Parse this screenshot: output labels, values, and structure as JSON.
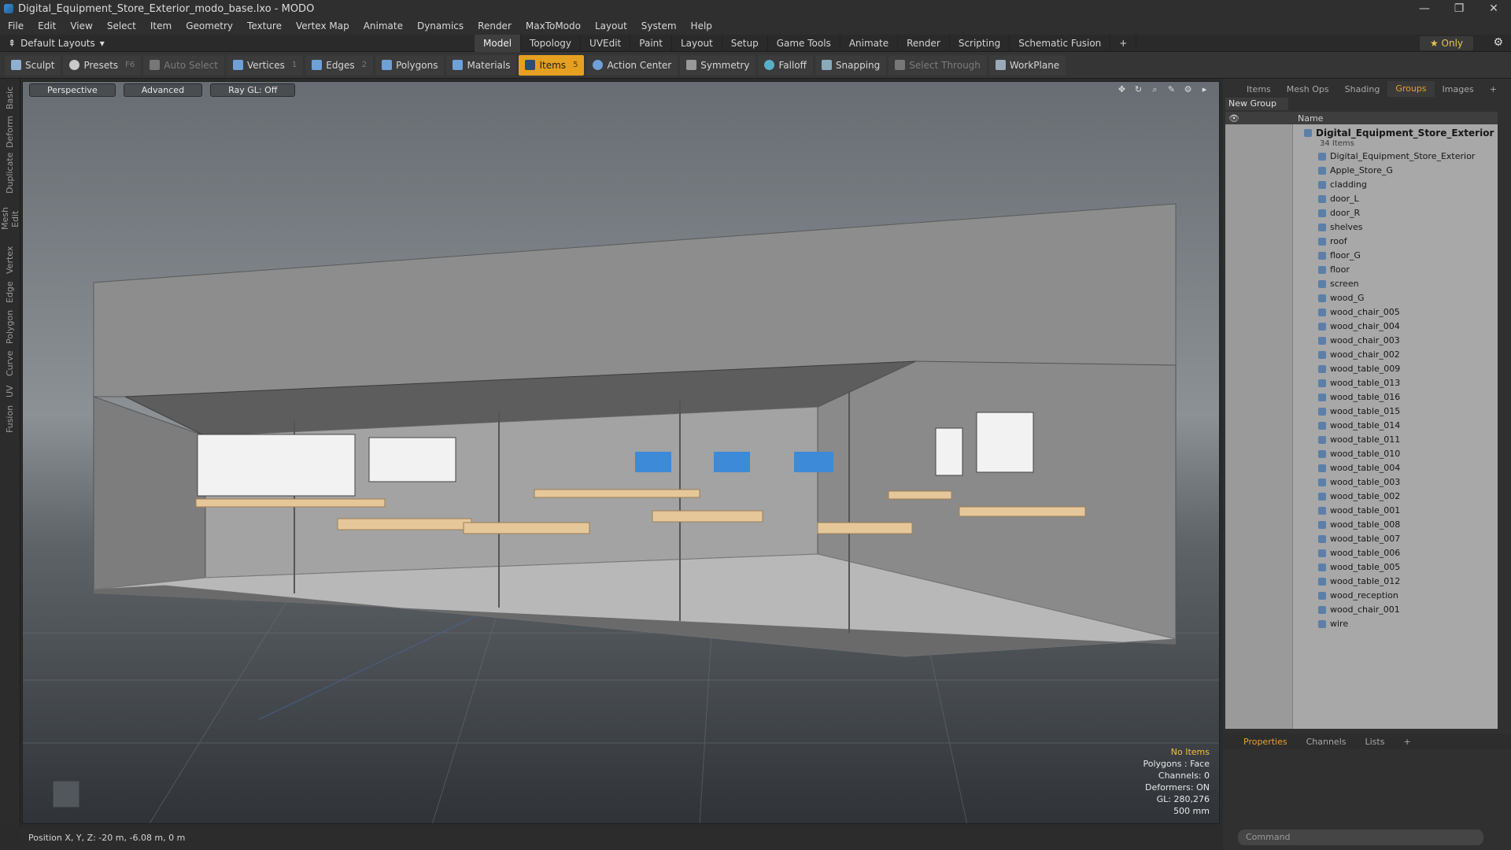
{
  "title": "Digital_Equipment_Store_Exterior_modo_base.lxo - MODO",
  "window_controls": {
    "minimize": "—",
    "maximize": "❐",
    "close": "✕"
  },
  "menu": [
    "File",
    "Edit",
    "View",
    "Select",
    "Item",
    "Geometry",
    "Texture",
    "Vertex Map",
    "Animate",
    "Dynamics",
    "Render",
    "MaxToModo",
    "Layout",
    "System",
    "Help"
  ],
  "layout_label": "Default Layouts",
  "layout_tabs": [
    "Model",
    "Topology",
    "UVEdit",
    "Paint",
    "Layout",
    "Setup",
    "Game Tools",
    "Animate",
    "Render",
    "Scripting",
    "Schematic Fusion"
  ],
  "layout_add": "+",
  "only_label": "Only",
  "toolbar": {
    "sculpt": "Sculpt",
    "presets": "Presets",
    "presets_key": "F6",
    "auto_select": "Auto Select",
    "vertices": "Vertices",
    "vertices_key": "1",
    "edges": "Edges",
    "edges_key": "2",
    "polygons": "Polygons",
    "materials": "Materials",
    "items": "Items",
    "items_key": "5",
    "action_center": "Action Center",
    "symmetry": "Symmetry",
    "falloff": "Falloff",
    "snapping": "Snapping",
    "select_through": "Select Through",
    "workplane": "WorkPlane"
  },
  "left_tabs": [
    "Basic",
    "Deform",
    "Duplicate",
    "Mesh Edit",
    "Vertex",
    "Edge",
    "Polygon",
    "Curve",
    "UV",
    "Fusion"
  ],
  "viewport": {
    "perspective": "Perspective",
    "advanced": "Advanced",
    "raygl": "Ray GL: Off",
    "stats": {
      "no_items": "No Items",
      "polygons": "Polygons : Face",
      "channels": "Channels: 0",
      "deformers": "Deformers: ON",
      "gl": "GL: 280,276",
      "scale": "500 mm"
    }
  },
  "status": "Position X, Y, Z:  -20 m, -6.08 m, 0 m",
  "right_panel": {
    "tabs": [
      "Items",
      "Mesh Ops",
      "Shading",
      "Groups",
      "Images",
      "+"
    ],
    "new_group": "New Group",
    "name_header": "Name",
    "root": "Digital_Equipment_Store_Exterior",
    "root_count": "34 Items",
    "items": [
      "Digital_Equipment_Store_Exterior",
      "Apple_Store_G",
      "cladding",
      "door_L",
      "door_R",
      "shelves",
      "roof",
      "floor_G",
      "floor",
      "screen",
      "wood_G",
      "wood_chair_005",
      "wood_chair_004",
      "wood_chair_003",
      "wood_chair_002",
      "wood_table_009",
      "wood_table_013",
      "wood_table_016",
      "wood_table_015",
      "wood_table_014",
      "wood_table_011",
      "wood_table_010",
      "wood_table_004",
      "wood_table_003",
      "wood_table_002",
      "wood_table_001",
      "wood_table_008",
      "wood_table_007",
      "wood_table_006",
      "wood_table_005",
      "wood_table_012",
      "wood_reception",
      "wood_chair_001",
      "wire"
    ],
    "props_tabs": [
      "Properties",
      "Channels",
      "Lists",
      "+"
    ]
  },
  "command_placeholder": "Command",
  "colors": {
    "accent": "#e5a021",
    "active_tab_text": "#e8a030"
  }
}
